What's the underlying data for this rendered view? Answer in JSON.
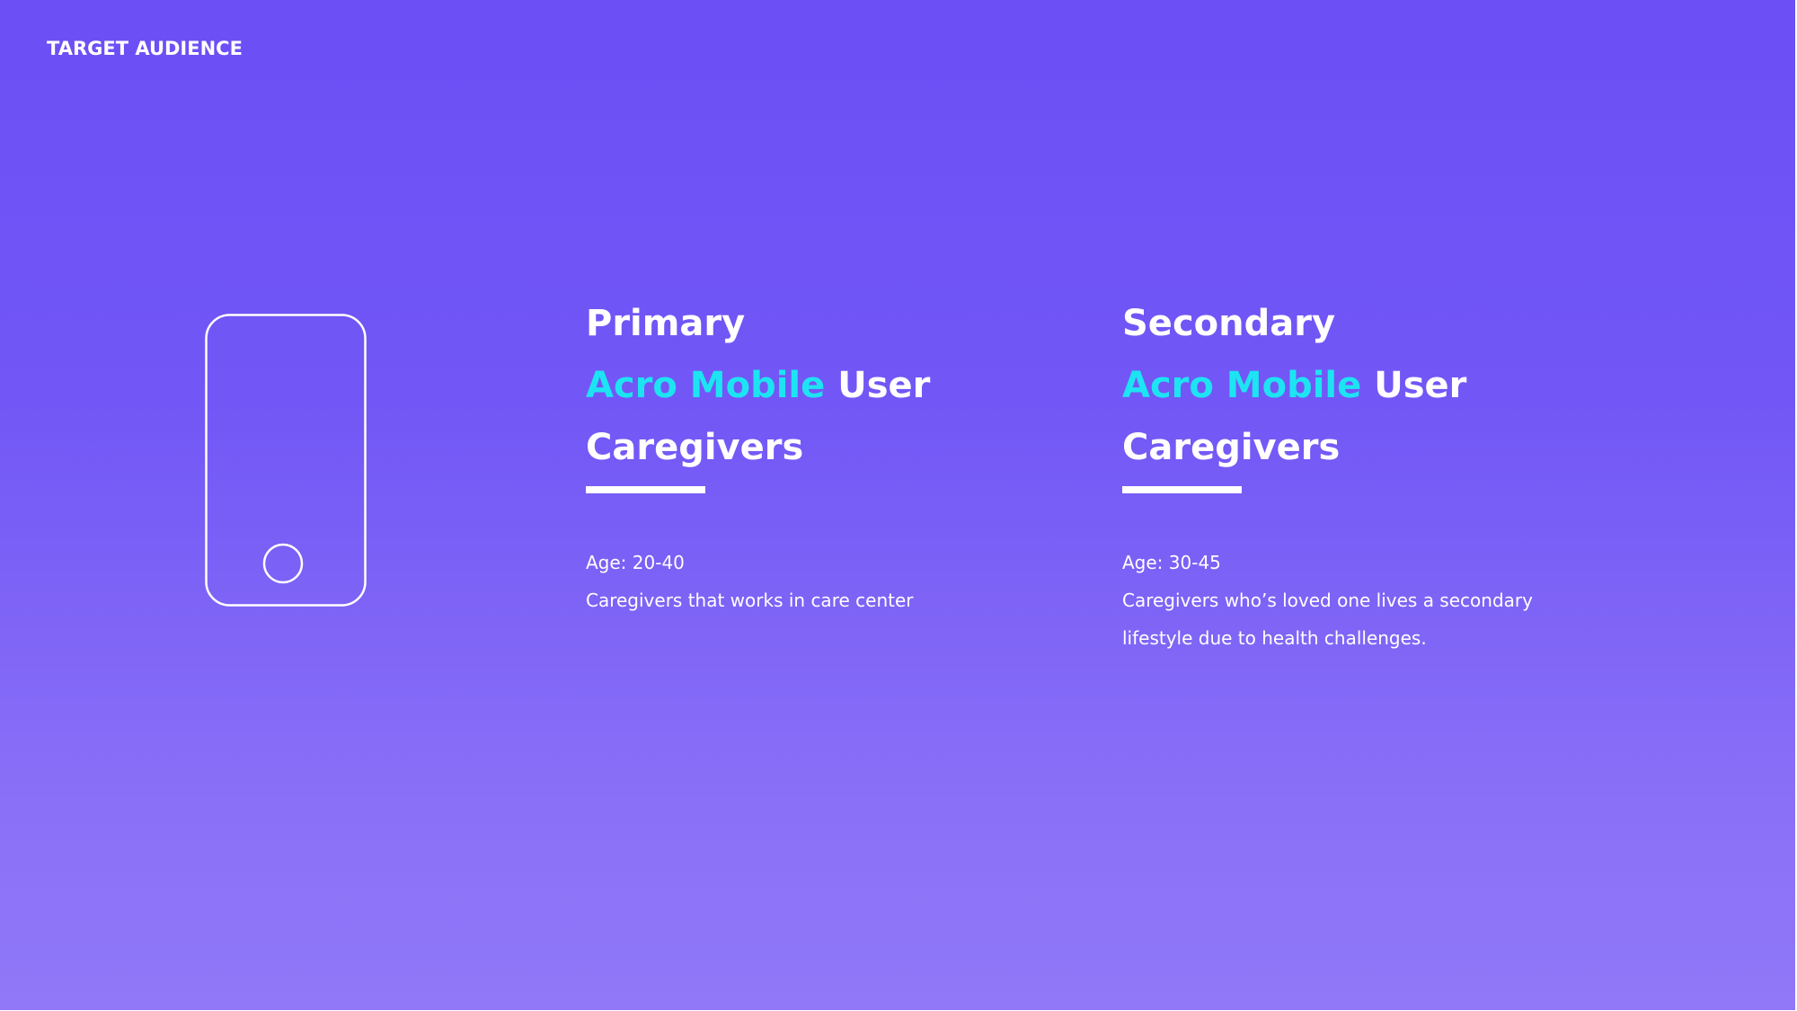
{
  "header": {
    "label": "TARGET AUDIENCE"
  },
  "icon": {
    "name": "smartphone-outline-icon",
    "stroke_color": "#ffffff"
  },
  "colors": {
    "background_top": "#6c4ff5",
    "background_bottom": "#9078f8",
    "accent": "#1de4f2",
    "text": "#ffffff"
  },
  "primary": {
    "title": "Primary",
    "product": "Acro Mobile",
    "product_suffix": "User",
    "role": "Caregivers",
    "age": "Age: 20-40",
    "description": [
      "Caregivers that works in care center"
    ]
  },
  "secondary": {
    "title": "Secondary",
    "product": "Acro Mobile",
    "product_suffix": "User",
    "role": "Caregivers",
    "age": "Age: 30-45",
    "description": [
      "Caregivers who’s loved one lives a secondary",
      "lifestyle due to health challenges."
    ]
  }
}
